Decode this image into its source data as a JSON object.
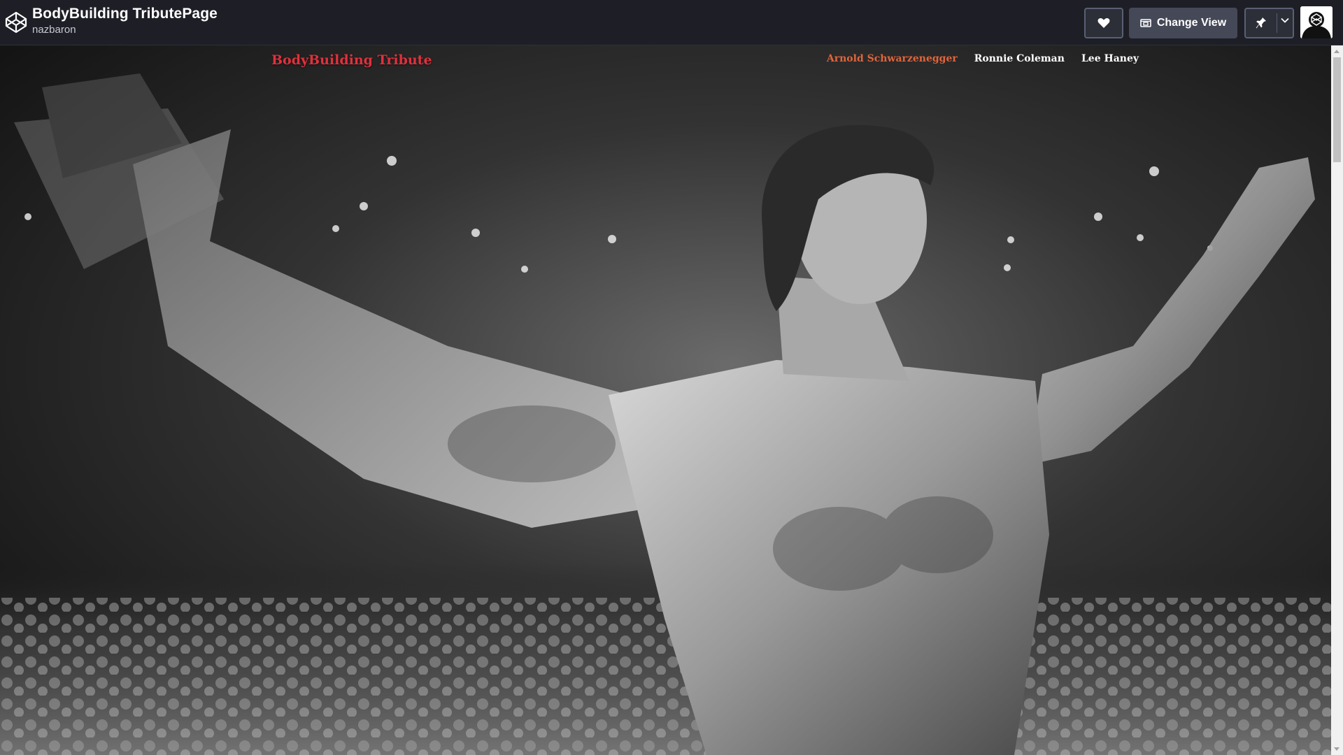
{
  "header": {
    "pen_title": "BodyBuilding TributePage",
    "author": "nazbaron",
    "change_view_label": "Change View",
    "icons": {
      "logo": "codepen-logo-icon",
      "like": "heart-icon",
      "change_view": "layout-icon",
      "pin": "pin-icon",
      "menu": "chevron-down-icon",
      "avatar": "user-avatar"
    }
  },
  "page": {
    "brand": "BodyBuilding Tribute",
    "nav": [
      {
        "label": "Arnold Schwarzenegger",
        "active": true
      },
      {
        "label": "Ronnie Coleman",
        "active": false
      },
      {
        "label": "Lee Haney",
        "active": false
      }
    ],
    "colors": {
      "brand": "#e0313c",
      "active_link": "#e2643a",
      "link": "#ffffff",
      "topbar": "#1e1f26"
    }
  }
}
